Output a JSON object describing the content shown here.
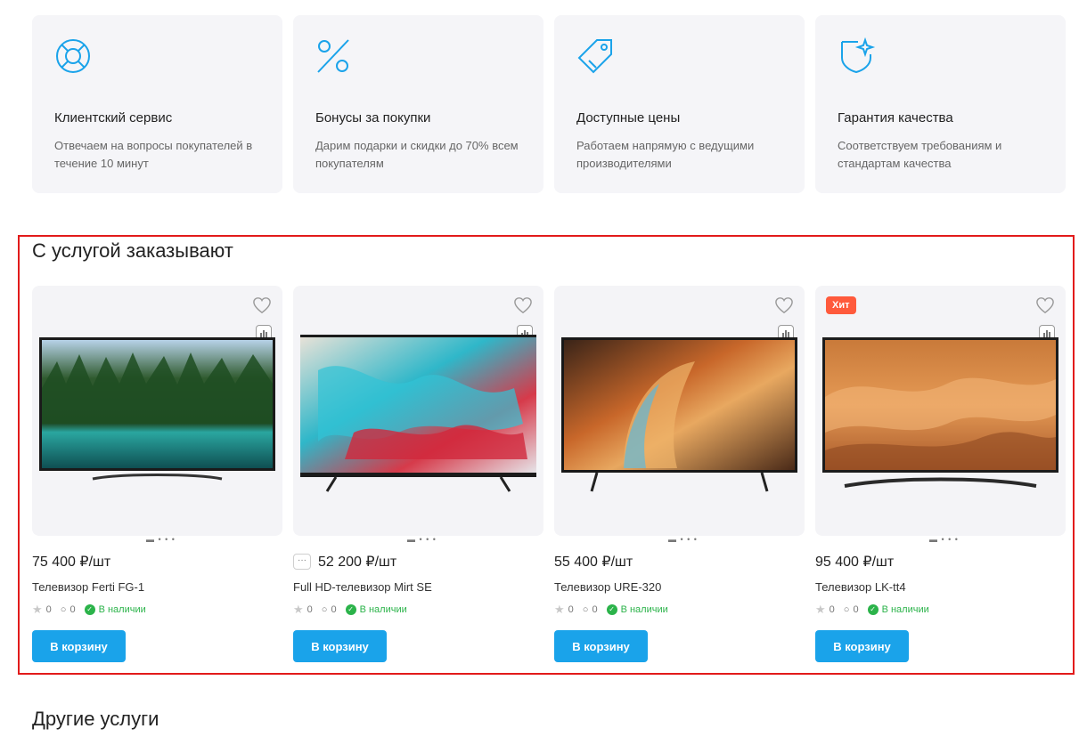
{
  "features": [
    {
      "icon": "lifebuoy-icon",
      "title": "Клиентский сервис",
      "desc": "Отвечаем на вопросы покупателей в течение 10 минут"
    },
    {
      "icon": "percent-icon",
      "title": "Бонусы за покупки",
      "desc": "Дарим подарки и скидки до 70% всем покупателям"
    },
    {
      "icon": "price-tag-icon",
      "title": "Доступные цены",
      "desc": "Работаем напрямую с ведущими производителями"
    },
    {
      "icon": "shield-star-icon",
      "title": "Гарантия качества",
      "desc": "Соответствуем требованиям и стандартам качества"
    }
  ],
  "section_title": "С услугой заказывают",
  "products": [
    {
      "price": "75 400 ₽/шт",
      "name": "Телевизор Ferti FG-1",
      "rating": "0",
      "reviews": "0",
      "stock": "В наличии",
      "button": "В корзину",
      "badge": ""
    },
    {
      "price": "52 200 ₽/шт",
      "name": "Full HD-телевизор Mirt SE",
      "rating": "0",
      "reviews": "0",
      "stock": "В наличии",
      "button": "В корзину",
      "badge": "",
      "more": "···"
    },
    {
      "price": "55 400 ₽/шт",
      "name": "Телевизор URE-320",
      "rating": "0",
      "reviews": "0",
      "stock": "В наличии",
      "button": "В корзину",
      "badge": ""
    },
    {
      "price": "95 400 ₽/шт",
      "name": "Телевизор LK-tt4",
      "rating": "0",
      "reviews": "0",
      "stock": "В наличии",
      "button": "В корзину",
      "badge": "Хит"
    }
  ],
  "other_title": "Другие услуги",
  "colors": {
    "accent": "#1aa3ea",
    "highlight": "#e21b1b",
    "badge": "#ff5a3c",
    "stock": "#2bb34a"
  }
}
